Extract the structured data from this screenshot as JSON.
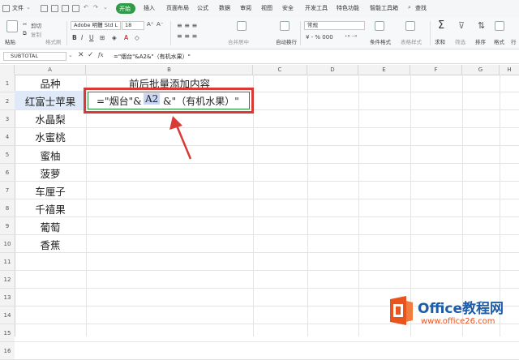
{
  "menubar": {
    "file": "文件",
    "tabs": [
      "开始",
      "插入",
      "页面布局",
      "公式",
      "数据",
      "审阅",
      "视图",
      "安全",
      "开发工具",
      "特色功能",
      "智能工具箱"
    ],
    "search": "查找"
  },
  "ribbon": {
    "paste": "粘贴",
    "cut": "剪切",
    "copy": "复制",
    "format_painter": "格式刷",
    "font_name": "Adobe 明體 Std L",
    "font_size": "18",
    "merge_center": "合并居中",
    "auto_wrap": "自动换行",
    "number_format": "常规",
    "conditional_format": "条件格式",
    "table_style": "表格样式",
    "sum": "求和",
    "filter": "筛选",
    "sort": "排序",
    "format": "格式",
    "rows_cols": "行"
  },
  "formula_bar": {
    "name_box": "SUBTOTAL",
    "fx": "fx",
    "formula": "=\"烟台\"&A2&\"（有机水果）\""
  },
  "columns": [
    "A",
    "B",
    "C",
    "D",
    "E",
    "F",
    "G",
    "H"
  ],
  "rows": [
    "1",
    "2",
    "3",
    "4",
    "5",
    "6",
    "7",
    "8",
    "9",
    "10",
    "11",
    "12",
    "13",
    "14",
    "15",
    "16"
  ],
  "cells": {
    "A1": "品种",
    "B1": "前后批量添加内容",
    "A2": "红富士苹果",
    "A3": "水晶梨",
    "A4": "水蜜桃",
    "A5": "蜜柚",
    "A6": "菠萝",
    "A7": "车厘子",
    "A8": "千禧果",
    "A9": "葡萄",
    "A10": "香蕉",
    "B2_p1": "=\"烟台\"&",
    "B2_ref": "A2",
    "B2_p2": "&\"（有机水果）\""
  },
  "watermark": {
    "title": "Office教程网",
    "url": "www.office26.com"
  },
  "colors": {
    "highlight": "#d83b35",
    "accent_green": "#2f9a48",
    "logo_orange": "#e8531e",
    "watermark_blue": "#1e5ca8",
    "cell_ref_bg": "#c7d5f3"
  }
}
